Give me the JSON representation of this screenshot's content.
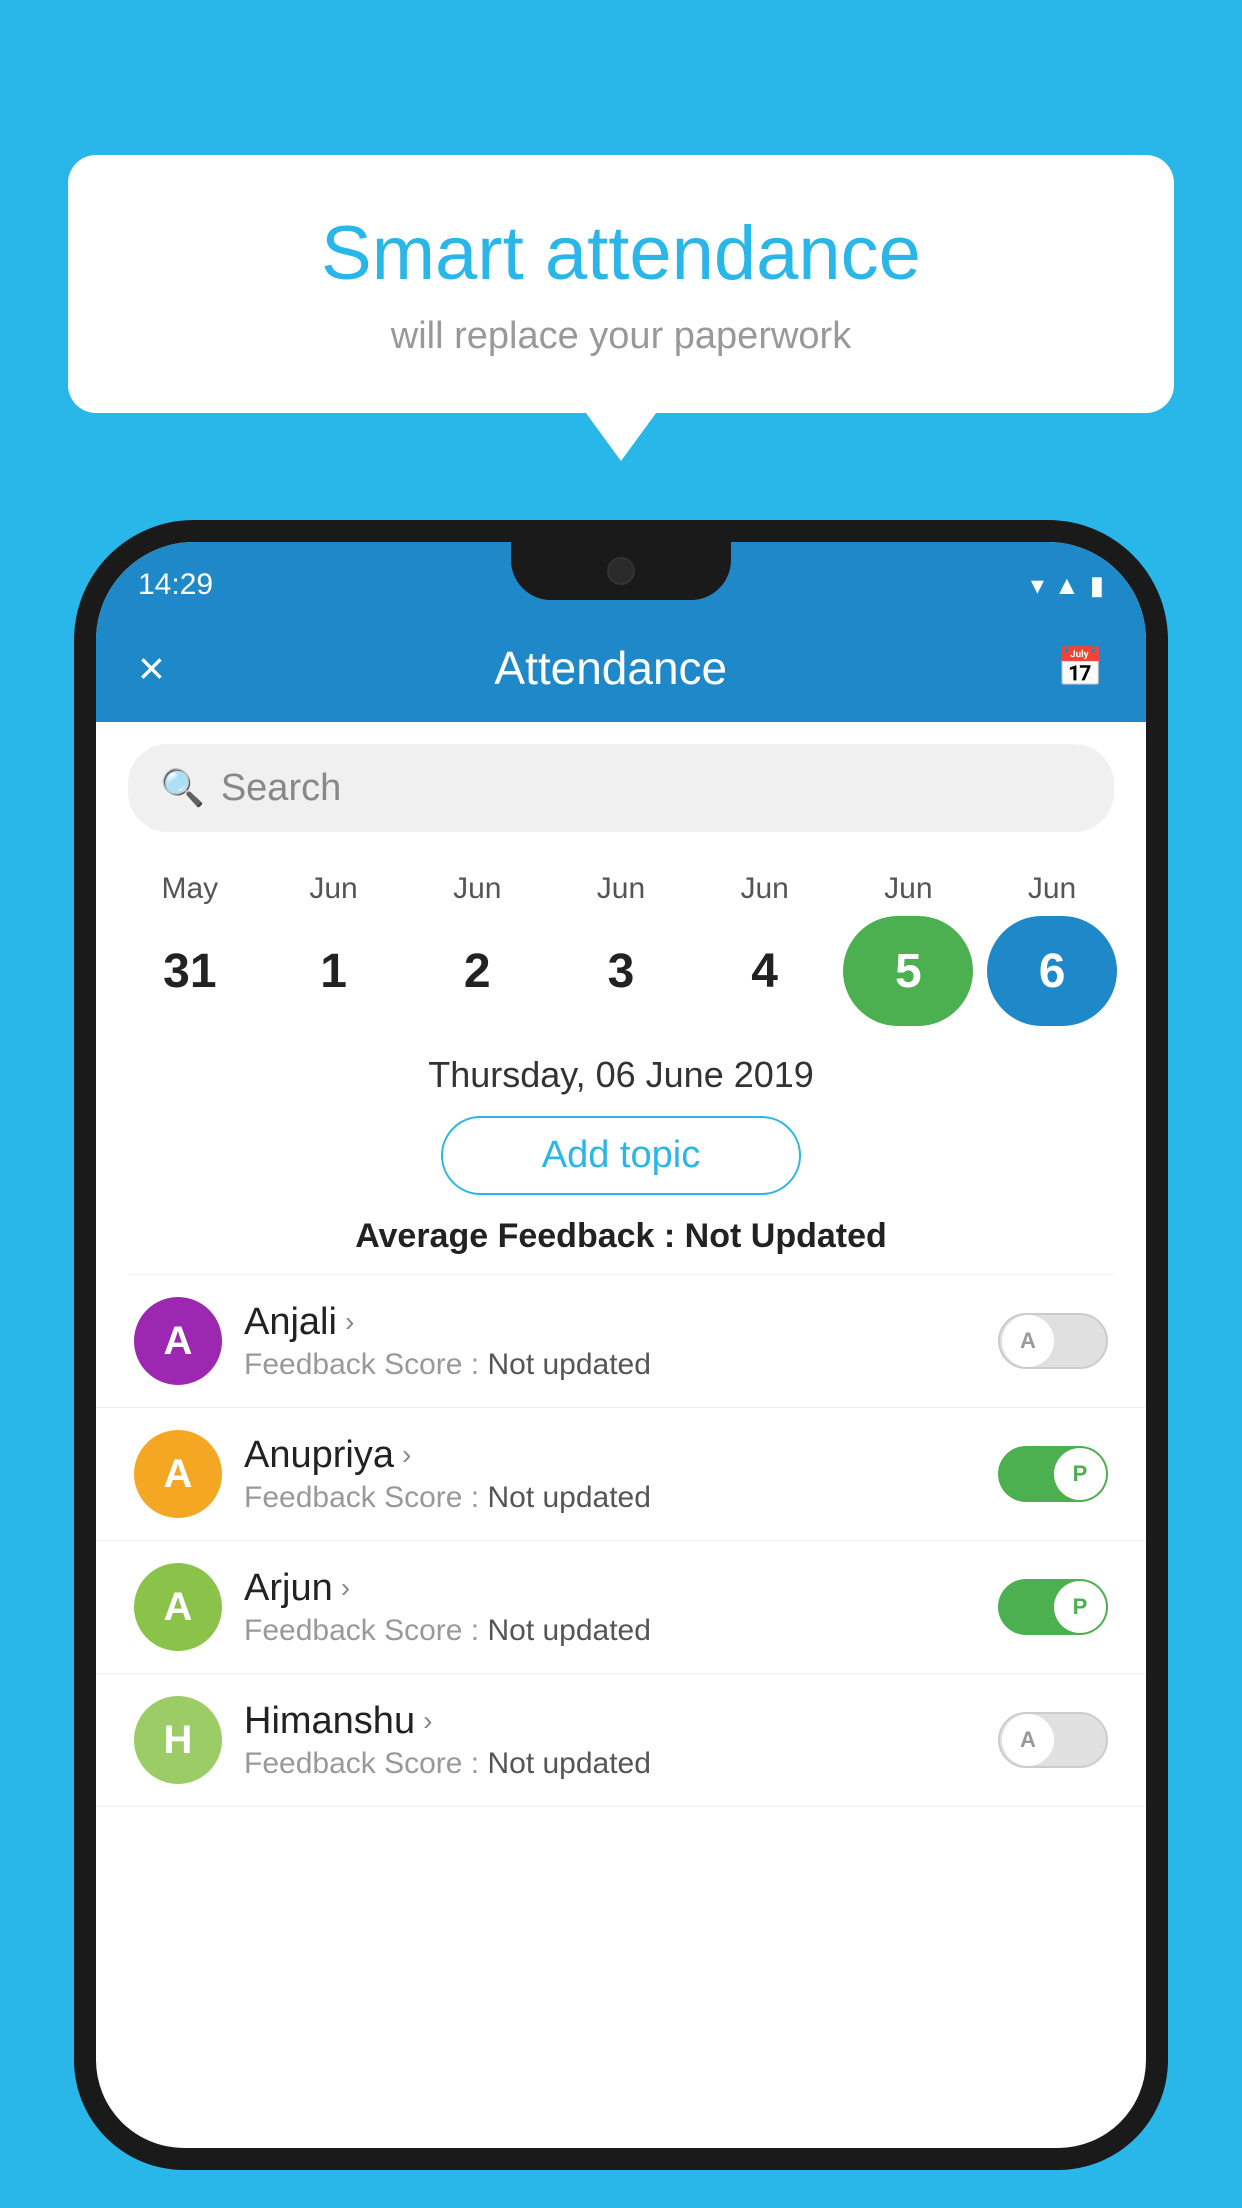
{
  "background_color": "#29b6e8",
  "bubble": {
    "title": "Smart attendance",
    "subtitle": "will replace your paperwork"
  },
  "status_bar": {
    "time": "14:29",
    "icons": [
      "wifi",
      "signal",
      "battery"
    ]
  },
  "header": {
    "title": "Attendance",
    "close_label": "×",
    "calendar_icon": "📅"
  },
  "search": {
    "placeholder": "Search"
  },
  "calendar": {
    "months": [
      "May",
      "Jun",
      "Jun",
      "Jun",
      "Jun",
      "Jun",
      "Jun"
    ],
    "dates": [
      "31",
      "1",
      "2",
      "3",
      "4",
      "5",
      "6"
    ],
    "today_index": 5,
    "selected_index": 6
  },
  "selected_date_label": "Thursday, 06 June 2019",
  "add_topic_label": "Add topic",
  "avg_feedback_label": "Average Feedback :",
  "avg_feedback_value": "Not Updated",
  "students": [
    {
      "name": "Anjali",
      "avatar_letter": "A",
      "avatar_color": "#9c27b0",
      "feedback_label": "Feedback Score :",
      "feedback_value": "Not updated",
      "toggle": "off",
      "toggle_letter": "A"
    },
    {
      "name": "Anupriya",
      "avatar_letter": "A",
      "avatar_color": "#f5a623",
      "feedback_label": "Feedback Score :",
      "feedback_value": "Not updated",
      "toggle": "on",
      "toggle_letter": "P"
    },
    {
      "name": "Arjun",
      "avatar_letter": "A",
      "avatar_color": "#8bc34a",
      "feedback_label": "Feedback Score :",
      "feedback_value": "Not updated",
      "toggle": "on",
      "toggle_letter": "P"
    },
    {
      "name": "Himanshu",
      "avatar_letter": "H",
      "avatar_color": "#9ccc65",
      "feedback_label": "Feedback Score :",
      "feedback_value": "Not updated",
      "toggle": "off",
      "toggle_letter": "A"
    }
  ]
}
